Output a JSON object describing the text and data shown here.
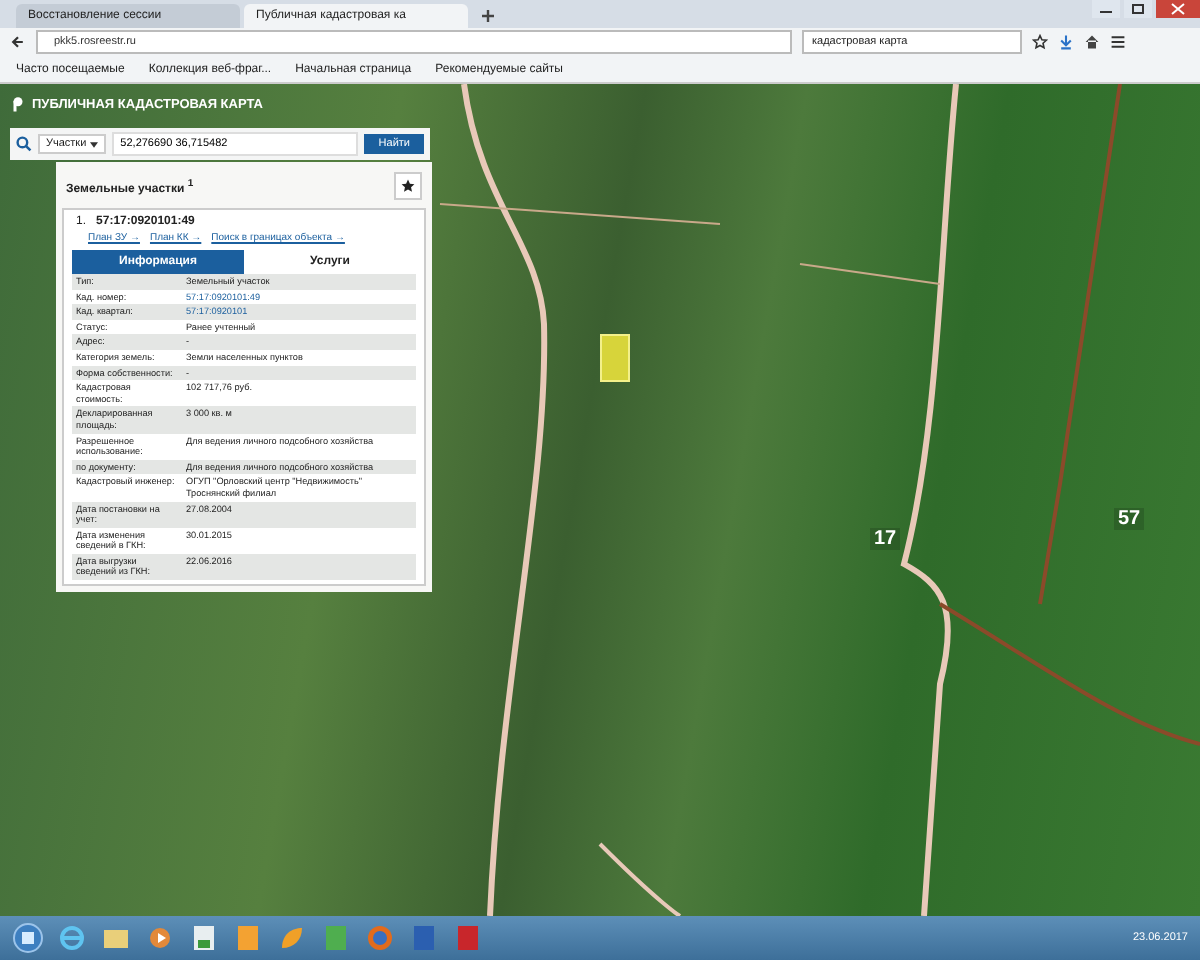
{
  "browser": {
    "tabs": [
      {
        "title": "Восстановление сессии",
        "selected": false
      },
      {
        "title": "Публичная кадастровая ка",
        "selected": true
      }
    ],
    "address": "pkk5.rosreestr.ru",
    "search": "кадастровая карта",
    "bookmarks": [
      "Часто посещаемые",
      "Коллекция веб-фраг...",
      "Начальная страница",
      "Рекомендуемые сайты"
    ]
  },
  "map": {
    "header": "ПУБЛИЧНАЯ КАДАСТРОВАЯ КАРТА",
    "search": {
      "filter": "Участки",
      "value": "52,276690 36,715482",
      "button": "Найти"
    },
    "results": {
      "title": "Земельные участки",
      "count": "1",
      "item": {
        "index": "1.",
        "number": "57:17:0920101:49",
        "links": [
          "План ЗУ →",
          "План КК →",
          "Поиск в границах объекта →"
        ],
        "tabs": [
          {
            "label": "Информация",
            "selected": true
          },
          {
            "label": "Услуги",
            "selected": false
          }
        ],
        "rows": [
          {
            "label": "Тип:",
            "value": "Земельный участок",
            "link": false
          },
          {
            "label": "Кад. номер:",
            "value": "57:17:0920101:49",
            "link": true
          },
          {
            "label": "Кад. квартал:",
            "value": "57:17:0920101",
            "link": true
          },
          {
            "label": "Статус:",
            "value": "Ранее учтенный",
            "link": false
          },
          {
            "label": "Адрес:",
            "value": "-",
            "link": false
          },
          {
            "label": "Категория земель:",
            "value": "Земли населенных пунктов",
            "link": false
          },
          {
            "label": "Форма собственности:",
            "value": "-",
            "link": false
          },
          {
            "label": "Кадастровая стоимость:",
            "value": "102 717,76 руб.",
            "link": false
          },
          {
            "label": "Декларированная площадь:",
            "value": "3 000 кв. м",
            "link": false
          },
          {
            "label": "Разрешенное использование:",
            "value": "Для ведения личного подсобного хозяйства",
            "link": false
          },
          {
            "label": "по документу:",
            "value": "Для ведения личного подсобного хозяйства",
            "link": false
          },
          {
            "label": "Кадастровый инженер:",
            "value": "ОГУП \"Орловский центр \"Недвижимость\" Троснянский филиал",
            "link": false
          },
          {
            "label": "Дата постановки на учет:",
            "value": "27.08.2004",
            "link": false
          },
          {
            "label": "Дата изменения сведений в ГКН:",
            "value": "30.01.2015",
            "link": false
          },
          {
            "label": "Дата выгрузки сведений из ГКН:",
            "value": "22.06.2016",
            "link": false
          }
        ]
      }
    },
    "labels": [
      "17",
      "57"
    ]
  },
  "taskbar": {
    "date": "23.06.2017"
  }
}
